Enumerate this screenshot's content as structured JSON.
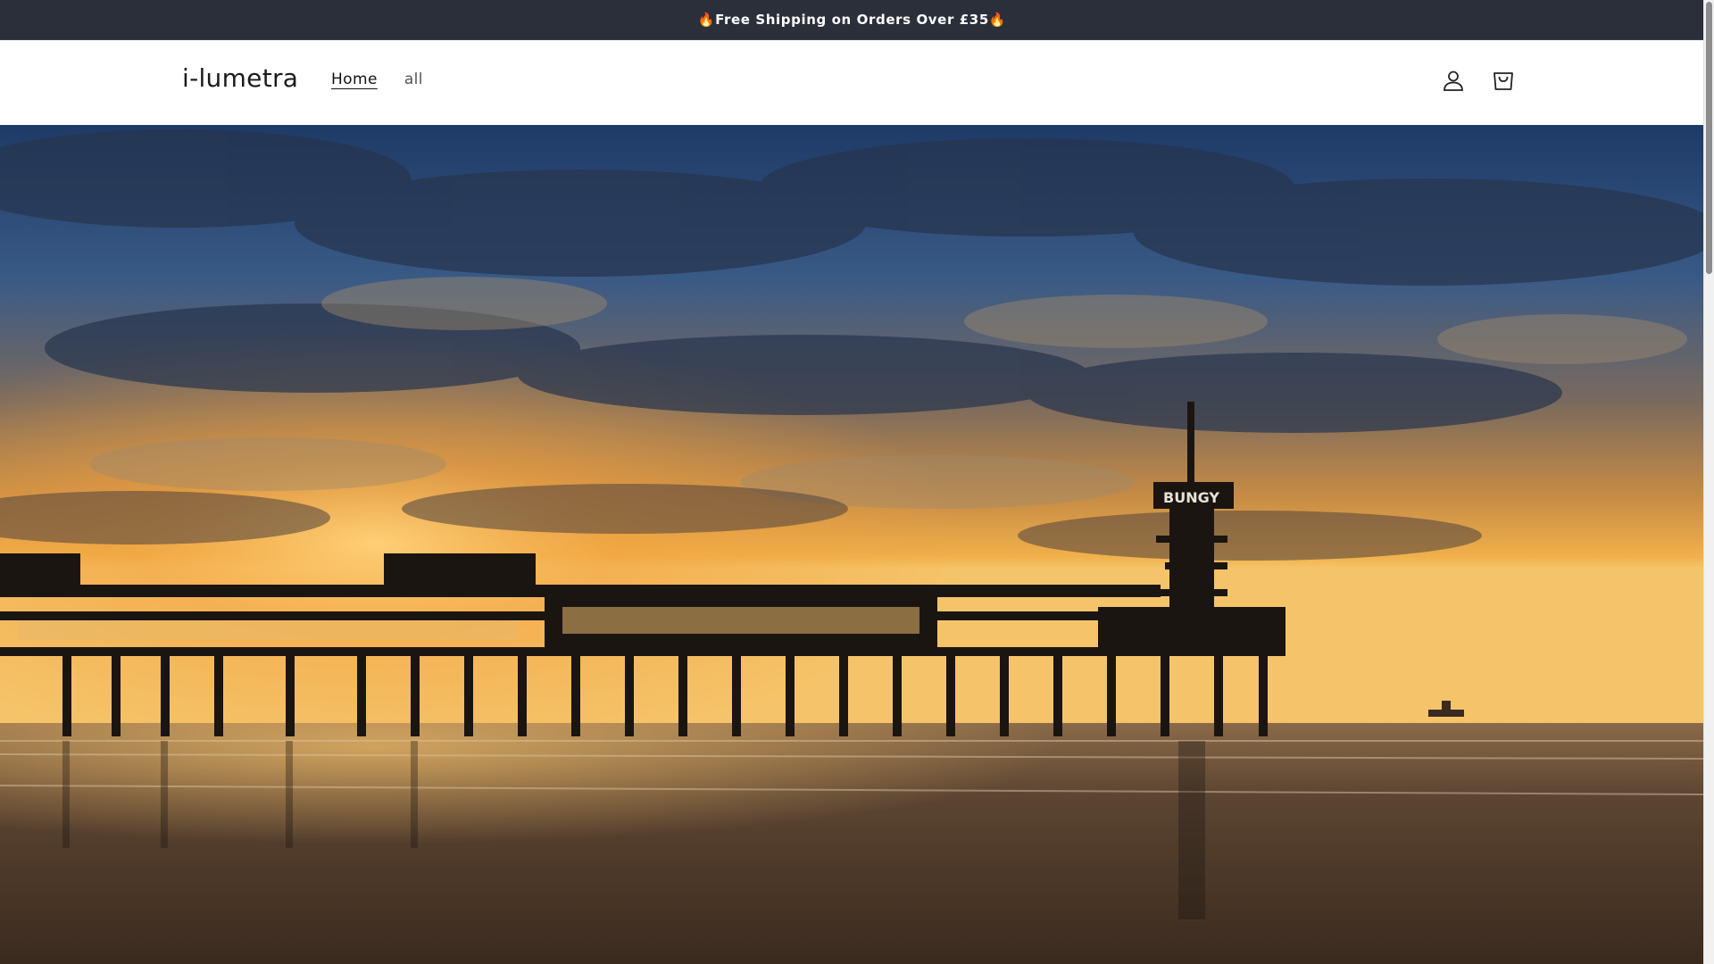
{
  "announcement": {
    "text": "🔥Free Shipping on Orders Over £35🔥"
  },
  "header": {
    "logo": "i-lumetra",
    "nav": [
      {
        "label": "Home",
        "active": true
      },
      {
        "label": "all",
        "active": false
      }
    ],
    "icons": [
      "account-icon",
      "cart-icon"
    ]
  },
  "hero": {
    "image": "pier-sunset-photo",
    "tower_sign": "BUNGY"
  },
  "colors": {
    "announcement_bg": "#2b2f3a",
    "header_bg": "#ffffff",
    "text": "#121212"
  }
}
